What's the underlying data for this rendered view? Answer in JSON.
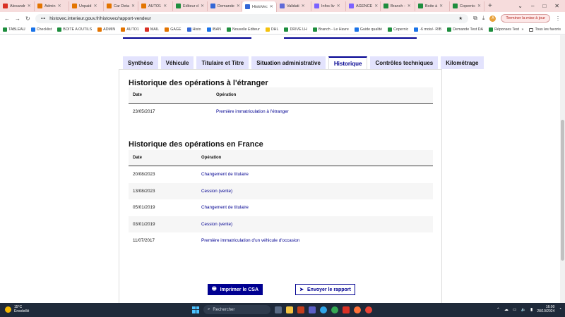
{
  "browser": {
    "tabs": [
      {
        "label": "Alesandr",
        "icon_color": "#d93025"
      },
      {
        "label": "Admin",
        "icon_color": "#e37400"
      },
      {
        "label": "Unpaid",
        "icon_color": "#e37400"
      },
      {
        "label": "Car Deta",
        "icon_color": "#e37400"
      },
      {
        "label": "AUTO1",
        "icon_color": "#e37400"
      },
      {
        "label": "Editeur d",
        "icon_color": "#1e8e3e"
      },
      {
        "label": "Demande",
        "icon_color": "#3367d6"
      },
      {
        "label": "HistoVec",
        "icon_color": "#3367d6",
        "active": true
      },
      {
        "label": "Validati",
        "icon_color": "#5f6ad8"
      },
      {
        "label": "Infos liv",
        "icon_color": "#7b61ff"
      },
      {
        "label": "AGENCE",
        "icon_color": "#7b61ff"
      },
      {
        "label": "Branch -",
        "icon_color": "#1e8e3e"
      },
      {
        "label": "Boite à",
        "icon_color": "#1e8e3e"
      },
      {
        "label": "Copernic",
        "icon_color": "#1e8e3e"
      }
    ],
    "url": "histovec.interieur.gouv.fr/histovec/rapport-vendeur",
    "update_label": "Terminer la mise à jour",
    "avatar_letter": "A",
    "bookmarks": [
      {
        "label": "TABLEAU",
        "icon_color": "#1e8e3e"
      },
      {
        "label": "Checklist",
        "icon_color": "#1a73e8"
      },
      {
        "label": "BOITE A OUTILS",
        "icon_color": "#1e8e3e"
      },
      {
        "label": "ADMIN",
        "icon_color": "#e37400"
      },
      {
        "label": "AUTO1",
        "icon_color": "#e37400"
      },
      {
        "label": "MAIL",
        "icon_color": "#d93025"
      },
      {
        "label": "GAGE",
        "icon_color": "#e37400"
      },
      {
        "label": "Histo",
        "icon_color": "#3367d6"
      },
      {
        "label": "IBAN",
        "icon_color": "#1a73e8"
      },
      {
        "label": "Nouvelle Editeur",
        "icon_color": "#1e8e3e"
      },
      {
        "label": "DHL",
        "icon_color": "#f4c20d"
      },
      {
        "label": "DRIVE LH",
        "icon_color": "#1e8e3e"
      },
      {
        "label": "Branch - Le Havre",
        "icon_color": "#1e8e3e"
      },
      {
        "label": "Guide qualité",
        "icon_color": "#1a73e8"
      },
      {
        "label": "Copernic",
        "icon_color": "#1e8e3e"
      },
      {
        "label": "-6 mois/- RIB",
        "icon_color": "#1a73e8"
      },
      {
        "label": "Demande Test DA",
        "icon_color": "#1e8e3e"
      },
      {
        "label": "Réponses Test DA",
        "icon_color": "#1e8e3e"
      }
    ],
    "all_bookmarks_label": "Tous les favoris"
  },
  "report": {
    "tabs": [
      {
        "label": "Synthèse"
      },
      {
        "label": "Véhicule"
      },
      {
        "label": "Titulaire et Titre"
      },
      {
        "label": "Situation administrative"
      },
      {
        "label": "Historique",
        "active": true
      },
      {
        "label": "Contrôles techniques"
      },
      {
        "label": "Kilométrage"
      }
    ],
    "foreign": {
      "title": "Historique des opérations à l'étranger",
      "col_date": "Date",
      "col_operation": "Opération",
      "rows": [
        {
          "date": "23/05/2017",
          "operation": "Première immatriculation à l'étranger"
        }
      ]
    },
    "france": {
      "title": "Historique des opérations en France",
      "col_date": "Date",
      "col_operation": "Opération",
      "rows": [
        {
          "date": "20/08/2023",
          "operation": "Changement de titulaire"
        },
        {
          "date": "13/08/2023",
          "operation": "Cession (vente)"
        },
        {
          "date": "05/01/2019",
          "operation": "Changement de titulaire"
        },
        {
          "date": "03/01/2019",
          "operation": "Cession (vente)"
        },
        {
          "date": "11/07/2017",
          "operation": "Première immatriculation d'un véhicule d'occasion"
        }
      ]
    },
    "print_button": "Imprimer le CSA",
    "send_button": "Envoyer le rapport",
    "accent_color": "#000091"
  },
  "taskbar": {
    "temperature": "15°C",
    "weather": "Ensoleillé",
    "search_placeholder": "Rechercher",
    "time": "16:00",
    "date": "28/10/2024"
  }
}
